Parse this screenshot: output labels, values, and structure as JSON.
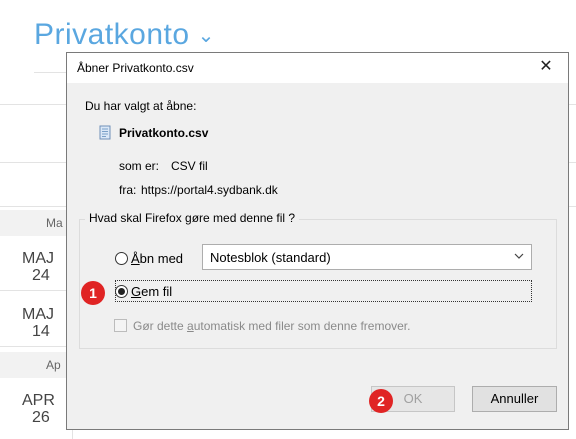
{
  "background": {
    "title": "Privatkonto",
    "title_chevron": "⌄",
    "months": [
      "Ma",
      "Ap"
    ],
    "dates": [
      {
        "month": "MAJ",
        "day": "24"
      },
      {
        "month": "MAJ",
        "day": "14"
      },
      {
        "month": "APR",
        "day": "26"
      }
    ]
  },
  "dialog": {
    "title": "Åbner Privatkonto.csv",
    "close_glyph": "✕",
    "intro": "Du har valgt at åbne:",
    "filename": "Privatkonto.csv",
    "type_label": "som er:",
    "type_value": "CSV fil",
    "from_label": "fra:",
    "from_value": "https://portal4.sydbank.dk",
    "question": "Hvad skal Firefox gøre med denne fil ?",
    "open_with_prefix": "",
    "open_with_accel": "Å",
    "open_with_rest": "bn med",
    "open_with_app": "Notesblok (standard)",
    "save_accel": "G",
    "save_rest": "em fil",
    "auto_before": "Gør dette ",
    "auto_accel": "a",
    "auto_after": "utomatisk med filer som denne fremover.",
    "ok_label": "OK",
    "cancel_label": "Annuller"
  },
  "annotations": {
    "step1": "1",
    "step2": "2",
    "color": "#e02424"
  },
  "state": {
    "selected_option": "Gem fil",
    "auto_checked": false,
    "ok_enabled": false
  }
}
